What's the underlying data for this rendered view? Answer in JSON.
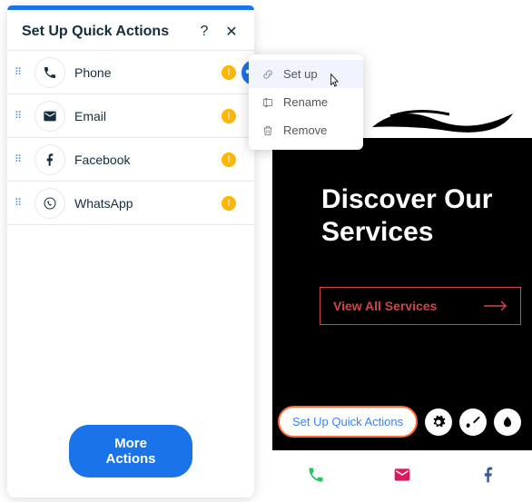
{
  "panel": {
    "title": "Set Up Quick Actions",
    "more_button": "More Actions"
  },
  "items": [
    {
      "label": "Phone"
    },
    {
      "label": "Email"
    },
    {
      "label": "Facebook"
    },
    {
      "label": "WhatsApp"
    }
  ],
  "context_menu": {
    "setup": "Set up",
    "rename": "Rename",
    "remove": "Remove"
  },
  "preview": {
    "heading_line1": "Discover Our",
    "heading_line2": "Services",
    "cta": "View All Services",
    "setup_label": "Set Up Quick Actions"
  }
}
